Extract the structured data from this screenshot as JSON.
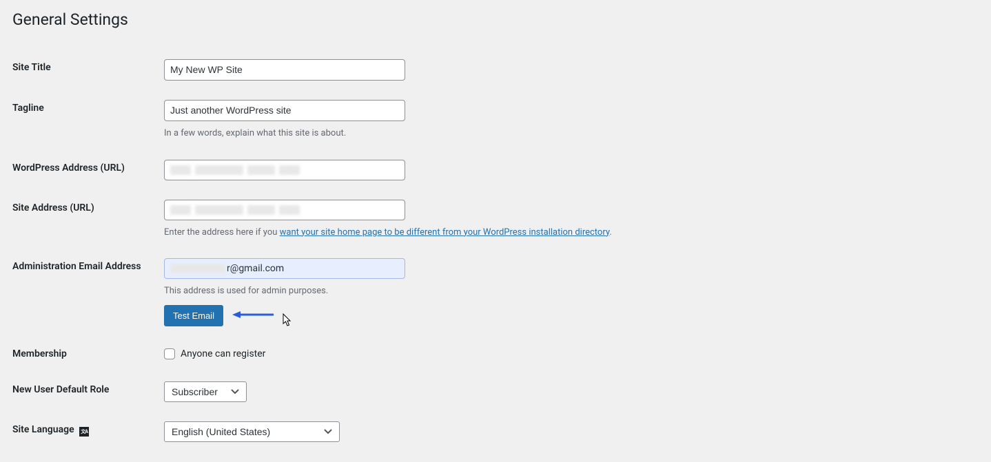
{
  "page": {
    "title": "General Settings"
  },
  "fields": {
    "site_title": {
      "label": "Site Title",
      "value": "My New WP Site"
    },
    "tagline": {
      "label": "Tagline",
      "value": "Just another WordPress site",
      "description": "In a few words, explain what this site is about."
    },
    "wp_address": {
      "label": "WordPress Address (URL)"
    },
    "site_address": {
      "label": "Site Address (URL)",
      "desc_prefix": "Enter the address here if you ",
      "desc_link": "want your site home page to be different from your WordPress installation directory",
      "desc_suffix": "."
    },
    "admin_email": {
      "label": "Administration Email Address",
      "visible_part": "r@gmail.com",
      "description": "This address is used for admin purposes.",
      "button": "Test Email"
    },
    "membership": {
      "label": "Membership",
      "checkbox_label": "Anyone can register",
      "checked": false
    },
    "default_role": {
      "label": "New User Default Role",
      "selected": "Subscriber"
    },
    "site_language": {
      "label": "Site Language",
      "selected": "English (United States)"
    }
  },
  "colors": {
    "primary": "#2271b1",
    "arrow": "#2a5cd8"
  }
}
